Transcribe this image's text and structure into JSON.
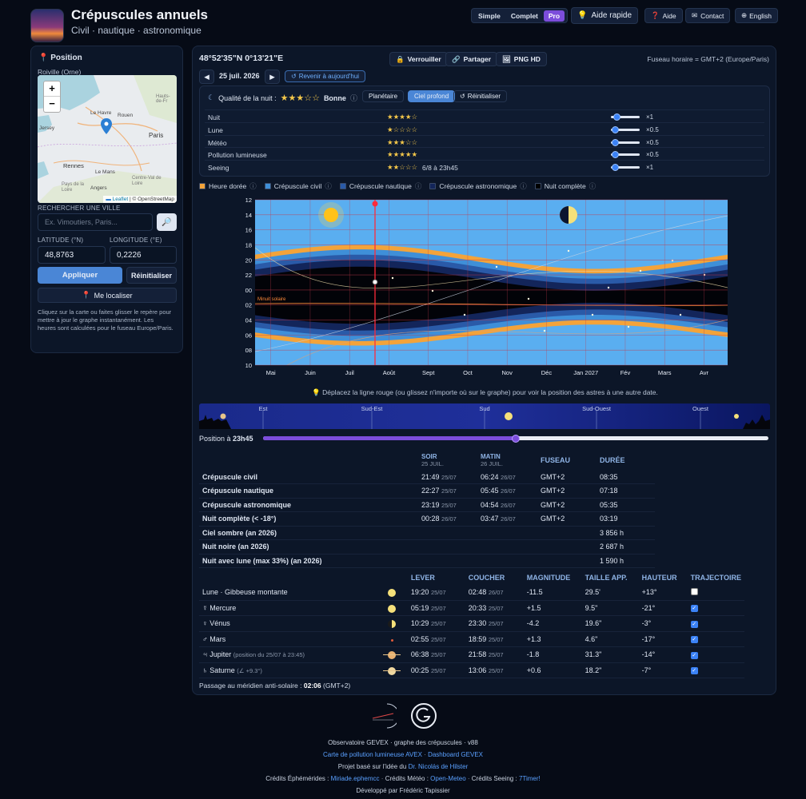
{
  "header": {
    "title": "Crépuscules annuels",
    "subtitle": "Civil · nautique · astronomique",
    "modes": [
      "Simple",
      "Complet",
      "Pro"
    ],
    "help_quick": "Aide rapide",
    "help": "Aide",
    "contact": "Contact",
    "lang": "English"
  },
  "position": {
    "title": "Position",
    "place": "Roiville (Orne)",
    "zoom_in": "+",
    "zoom_out": "−",
    "map_labels": [
      "Le Havre",
      "Rouen",
      "Paris",
      "Rennes",
      "Le Mans",
      "Angers",
      "Jersey",
      "Centre-Val de Loire",
      "Pays de la Loire",
      "Hauts-de-Fr"
    ],
    "attribution_leaflet": "Leaflet",
    "attribution_sep": "| ©",
    "attribution_osm": "OpenStreetMap",
    "search_label": "RECHERCHER UNE VILLE",
    "search_placeholder": "Ex. Vimoutiers, Paris...",
    "lat_label": "LATITUDE (°N)",
    "lon_label": "LONGITUDE (°E)",
    "lat": "48,8763",
    "lon": "0,2226",
    "apply": "Appliquer",
    "reset": "Réinitialiser",
    "locate": "Me localiser",
    "help_text": "Cliquez sur la carte ou faites glisser le repère pour mettre à jour le graphe instantanément. Les heures sont calculées pour le fuseau Europe/Paris."
  },
  "top": {
    "coords": "48°52'35\"N  0°13'21\"E",
    "lock": "Verrouiller",
    "share": "Partager",
    "png": "PNG HD",
    "tz": "Fuseau horaire = GMT+2 (Europe/Paris)",
    "date": "25 juil. 2026",
    "today": "Revenir à aujourd'hui"
  },
  "quality": {
    "label": "Qualité de la nuit :",
    "stars": "★★★☆☆",
    "value": "Bonne",
    "planet": "Planétaire",
    "deep": "Ciel profond",
    "reset": "Réinitialiser",
    "rows": [
      {
        "name": "Nuit",
        "stars": "★★★★☆",
        "note": "",
        "weight": "×1",
        "level": 0.1
      },
      {
        "name": "Lune",
        "stars": "★☆☆☆☆",
        "note": "",
        "weight": "×0.5",
        "level": 0.05
      },
      {
        "name": "Météo",
        "stars": "★★★☆☆",
        "note": "",
        "weight": "×0.5",
        "level": 0.05
      },
      {
        "name": "Pollution lumineuse",
        "stars": "★★★★★",
        "note": "",
        "weight": "×0.5",
        "level": 0.05
      },
      {
        "name": "Seeing",
        "stars": "★★☆☆☆",
        "note": "6/8 à 23h45",
        "weight": "×1",
        "level": 0.05
      }
    ]
  },
  "legend": [
    {
      "label": "Heure dorée",
      "color": "#f3a33a"
    },
    {
      "label": "Crépuscule civil",
      "color": "#3f8fd8"
    },
    {
      "label": "Crépuscule nautique",
      "color": "#2a5aa8"
    },
    {
      "label": "Crépuscule astronomique",
      "color": "#13255a"
    },
    {
      "label": "Nuit complète",
      "color": "#000000"
    }
  ],
  "chart_data": {
    "type": "area",
    "y_ticks": [
      "12",
      "14",
      "16",
      "18",
      "20",
      "22",
      "00",
      "02",
      "04",
      "06",
      "08",
      "10"
    ],
    "x_ticks": [
      "Mai",
      "Juin",
      "Juil",
      "Août",
      "Sept",
      "Oct",
      "Nov",
      "Déc",
      "Jan 2027",
      "Fév",
      "Mars",
      "Avr"
    ],
    "annotation": "Minuit solaire",
    "hint": "Déplacez la ligne rouge (ou glissez n'importe où sur le graphe) pour voir la position des astres à une autre date."
  },
  "horizon": {
    "labels": [
      "Est",
      "Sud-Est",
      "Sud",
      "Sud-Ouest",
      "Ouest"
    ],
    "position_label": "Position à",
    "position_time": "23h45",
    "position_level": 0.5
  },
  "twilight": {
    "headers": {
      "evening": "SOIR",
      "evening_date": "25 JUIL.",
      "morning": "MATIN",
      "morning_date": "26 JUIL.",
      "tz": "FUSEAU",
      "dur": "DURÉE"
    },
    "rows": [
      {
        "name": "Crépuscule civil",
        "e": "21:49",
        "ed": "25/07",
        "m": "06:24",
        "md": "26/07",
        "tz": "GMT+2",
        "dur": "08:35"
      },
      {
        "name": "Crépuscule nautique",
        "e": "22:27",
        "ed": "25/07",
        "m": "05:45",
        "md": "26/07",
        "tz": "GMT+2",
        "dur": "07:18"
      },
      {
        "name": "Crépuscule astronomique",
        "e": "23:19",
        "ed": "25/07",
        "m": "04:54",
        "md": "26/07",
        "tz": "GMT+2",
        "dur": "05:35"
      },
      {
        "name": "Nuit complète (< -18°)",
        "e": "00:28",
        "ed": "26/07",
        "m": "03:47",
        "md": "26/07",
        "tz": "GMT+2",
        "dur": "03:19"
      },
      {
        "name": "Ciel sombre (an 2026)",
        "e": "",
        "ed": "",
        "m": "",
        "md": "",
        "tz": "",
        "dur": "3 856 h"
      },
      {
        "name": "Nuit noire (an 2026)",
        "e": "",
        "ed": "",
        "m": "",
        "md": "",
        "tz": "",
        "dur": "2 687 h"
      },
      {
        "name": "Nuit avec lune (max 33%) (an 2026)",
        "e": "",
        "ed": "",
        "m": "",
        "md": "",
        "tz": "",
        "dur": "1 590 h"
      }
    ]
  },
  "planets": {
    "headers": {
      "rise": "LEVER",
      "set": "COUCHER",
      "mag": "MAGNITUDE",
      "size": "TAILLE APP.",
      "alt": "HAUTEUR",
      "traj": "TRAJECTOIRE"
    },
    "rows": [
      {
        "name": "Lune · Gibbeuse montante",
        "note": "",
        "r": "19:20",
        "rd": "25/07",
        "s": "02:48",
        "sd": "26/07",
        "mag": "-11.5",
        "size": "29.5'",
        "alt": "+13°",
        "checked": false
      },
      {
        "name": "☿ Mercure",
        "note": "",
        "r": "05:19",
        "rd": "25/07",
        "s": "20:33",
        "sd": "25/07",
        "mag": "+1.5",
        "size": "9.5\"",
        "alt": "-21°",
        "checked": true
      },
      {
        "name": "♀ Vénus",
        "note": "",
        "r": "10:29",
        "rd": "25/07",
        "s": "23:30",
        "sd": "25/07",
        "mag": "-4.2",
        "size": "19.6\"",
        "alt": "-3°",
        "checked": true
      },
      {
        "name": "♂ Mars",
        "note": "",
        "r": "02:55",
        "rd": "25/07",
        "s": "18:59",
        "sd": "25/07",
        "mag": "+1.3",
        "size": "4.6\"",
        "alt": "-17°",
        "checked": true
      },
      {
        "name": "♃ Jupiter",
        "note": "(position du 25/07 à 23:45)",
        "r": "06:38",
        "rd": "25/07",
        "s": "21:58",
        "sd": "25/07",
        "mag": "-1.8",
        "size": "31.3\"",
        "alt": "-14°",
        "checked": true
      },
      {
        "name": "♄ Saturne",
        "note": "(∠ +9.3°)",
        "r": "00:25",
        "rd": "25/07",
        "s": "13:06",
        "sd": "25/07",
        "mag": "+0.6",
        "size": "18.2\"",
        "alt": "-7°",
        "checked": true
      }
    ],
    "meridian_label": "Passage au méridien anti-solaire :",
    "meridian_time": "02:06",
    "meridian_tz": "(GMT+2)"
  },
  "footer": {
    "line1": "Observatoire GEVEX · graphe des crépuscules · v88",
    "link1": "Carte de pollution lumineuse AVEX",
    "link2": "Dashboard GEVEX",
    "idea": "Projet basé sur l'idée du",
    "idea_link": "Dr. Nicolás de Hilster",
    "eph_label": "Crédits Éphémérides :",
    "eph": "Miriade.ephemcc",
    "meteo_label": "Crédits Météo :",
    "meteo": "Open-Meteo",
    "seeing_label": "Crédits Seeing :",
    "seeing": "7Timer!",
    "dev": "Développé par Frédéric Tapissier"
  }
}
